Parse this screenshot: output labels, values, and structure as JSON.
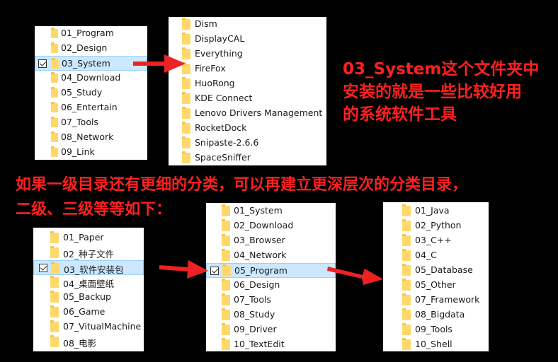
{
  "panels": {
    "p1": {
      "items": [
        "01_Program",
        "02_Design",
        "03_System",
        "04_Download",
        "05_Study",
        "06_Entertain",
        "07_Tools",
        "08_Network",
        "09_Link"
      ],
      "selected": 2
    },
    "p2": {
      "items": [
        "Dism",
        "DisplayCAL",
        "Everything",
        "FireFox",
        "HuoRong",
        "KDE Connect",
        "Lenovo Drivers Management",
        "RocketDock",
        "Snipaste-2.6.6",
        "SpaceSniffer"
      ]
    },
    "p3": {
      "items": [
        "01_Paper",
        "02_种子文件",
        "03_软件安装包",
        "04_桌面壁纸",
        "05_Backup",
        "06_Game",
        "07_VitualMachine",
        "08_电影"
      ],
      "selected": 2
    },
    "p4": {
      "items": [
        "01_System",
        "02_Download",
        "03_Browser",
        "04_Network",
        "05_Program",
        "06_Design",
        "07_Tools",
        "08_Study",
        "09_Driver",
        "10_TextEdit"
      ],
      "selected": 4
    },
    "p5": {
      "items": [
        "01_Java",
        "02_Python",
        "03_C++",
        "04_C",
        "05_Database",
        "05_Other",
        "07_Framework",
        "08_Bigdata",
        "09_Tools",
        "10_Shell"
      ]
    }
  },
  "notes": {
    "right_line1": "03_System这个文件夹中",
    "right_line2": "安装的就是一些比较好用",
    "right_line3": "的系统软件工具",
    "mid_line1": "如果一级目录还有更细的分类，可以再建立更深层次的分类目录，",
    "mid_line2": "二级、三级等等如下："
  },
  "colors": {
    "accent": "#ff2020",
    "selection": "#cce8ff",
    "folder": "#ffd86b"
  }
}
